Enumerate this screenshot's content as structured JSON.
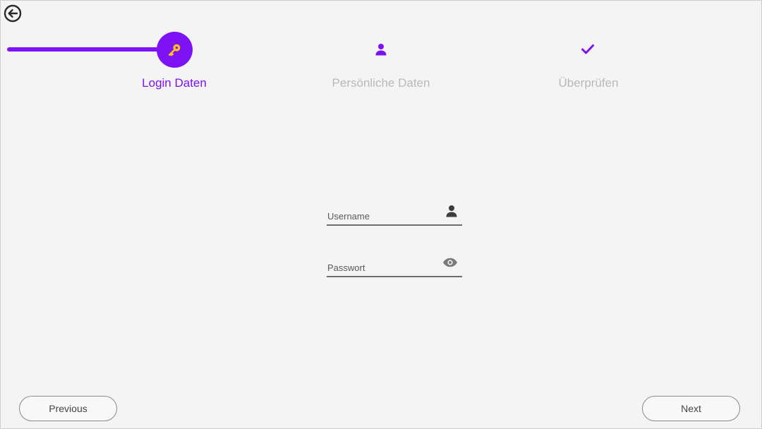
{
  "colors": {
    "accent": "#7d12f4",
    "key_icon": "#ffc21a",
    "inactive_label": "#b9b9b9",
    "field_line": "#6e6e6e"
  },
  "header": {
    "back_icon": "back-arrow-circle-icon"
  },
  "stepper": {
    "progress": 0.0,
    "steps": [
      {
        "label": "Login Daten",
        "icon": "key-icon",
        "state": "active"
      },
      {
        "label": "Persönliche Daten",
        "icon": "person-icon",
        "state": "inactive"
      },
      {
        "label": "Überprüfen",
        "icon": "check-icon",
        "state": "inactive"
      }
    ]
  },
  "form": {
    "username": {
      "placeholder": "Username",
      "value": "",
      "icon": "person-icon"
    },
    "password": {
      "placeholder": "Passwort",
      "value": "",
      "icon": "eye-icon"
    }
  },
  "footer": {
    "previous_label": "Previous",
    "next_label": "Next"
  }
}
